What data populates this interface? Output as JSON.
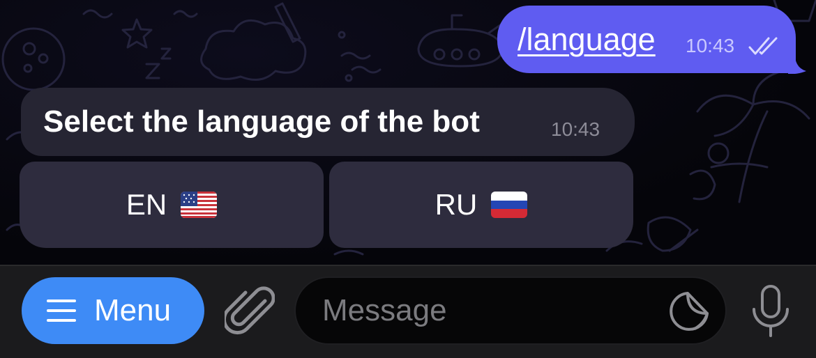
{
  "chat": {
    "outgoing": {
      "text": "/language",
      "time": "10:43",
      "status_icon": "double-check-icon"
    },
    "incoming": {
      "text": "Select the language of the bot",
      "time": "10:43"
    },
    "keyboard": {
      "buttons": [
        {
          "label": "EN",
          "flag": "us-flag-icon"
        },
        {
          "label": "RU",
          "flag": "ru-flag-icon"
        }
      ]
    }
  },
  "input_bar": {
    "menu_label": "Menu",
    "menu_icon": "hamburger-icon",
    "attach_icon": "paperclip-icon",
    "placeholder": "Message",
    "sticker_icon": "sticker-icon",
    "mic_icon": "microphone-icon"
  },
  "colors": {
    "outgoing_bubble": "#5f5cf1",
    "incoming_bubble": "#262533",
    "keyboard_button": "#2e2c3e",
    "menu_button": "#3e8bf6",
    "input_bar": "#1b1b1d"
  }
}
